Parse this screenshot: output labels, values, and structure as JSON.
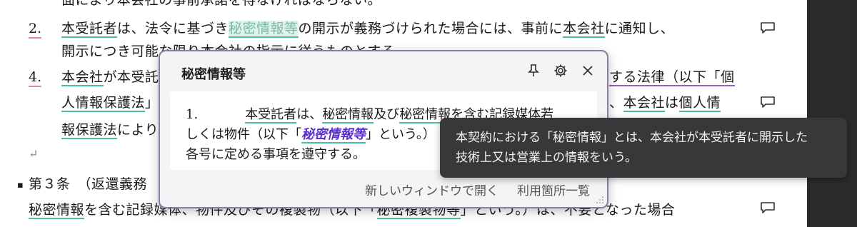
{
  "doc": {
    "l0": "面により本会社の事前承諾を得なければならない。",
    "l1_num": "2.",
    "l1_a": "本受託者",
    "l1_b": "は、法令に基づき",
    "l1_c": "秘密情報等",
    "l1_d": "の開示が義務づけられた場合には、事前に",
    "l1_e": "本会社",
    "l1_f": "に通知し、",
    "l2": "開示につき可能な限り本会社の指示に従うものとする。",
    "l3_num": "4.",
    "l3_a": "本会社",
    "l3_b": "が本受託",
    "l3_c": "する法律（以下「個",
    "l4_a": "人情報保護法",
    "l4_b": "」",
    "l4_c": "、",
    "l4_d": "本会社",
    "l4_e": "は",
    "l4_f": "個人情",
    "l5_a": "報保護法",
    "l5_b": "により",
    "para_mark": "↵",
    "art_bullet": "▪",
    "art": "第３条　（返還義務",
    "l7_a": "秘密情報",
    "l7_b": "を含む記録媒体、物件及びその複製物（以下「",
    "l7_c": "秘密複製物等",
    "l7_d": "」という。）は、不要となった場合"
  },
  "popup": {
    "title": "秘密情報等",
    "body_num": "1.",
    "body_a": "本受託者",
    "body_b": "は、",
    "body_c": "秘密情報",
    "body_d": "及び",
    "body_e": "秘密情報",
    "body_f": "を含む記録媒体若",
    "body_g": "しくは物件（以下「",
    "body_term": "秘密情報等",
    "body_h": "」という。）",
    "body_i": "各号に定める事項を遵守する。",
    "footer_open": "新しいウィンドウで開く",
    "footer_list": "利用箇所一覧"
  },
  "tooltip": {
    "line1": "本契約における「秘密情報」とは、本会社が本受託者に開示した",
    "line2": "技術上又は営業上の情報をいう。"
  }
}
